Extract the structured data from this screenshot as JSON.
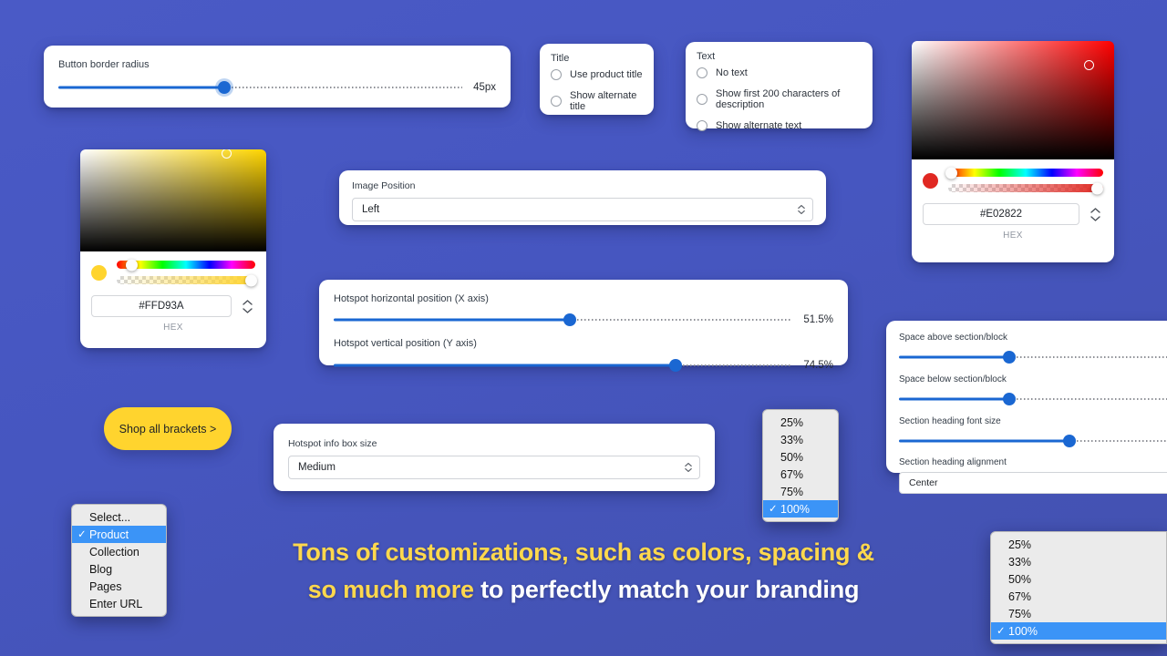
{
  "theme": {
    "background_top": "#4A5AC6",
    "background_bottom": "#4351AE",
    "accent_blue": "#1A67D2",
    "accent_yellow": "#FFD42E",
    "headline_yellow": "#FFD84D",
    "menu_highlight": "#3B94F7"
  },
  "border_radius_card": {
    "label": "Button border radius",
    "value": "45px",
    "fill_percent": 41
  },
  "title_radios": {
    "title": "Title",
    "options": [
      {
        "label": "Use product title",
        "selected": false
      },
      {
        "label": "Show alternate title",
        "selected": false
      }
    ]
  },
  "text_radios": {
    "title": "Text",
    "options": [
      {
        "label": "No text",
        "selected": false
      },
      {
        "label": "Show first 200 characters of description",
        "selected": false
      },
      {
        "label": "Show alternate text",
        "selected": false
      }
    ]
  },
  "color_picker_yellow": {
    "hex": "#FFD93A",
    "hex_label": "HEX",
    "swatch_color": "#FFD42E",
    "hue_percent": 11,
    "alpha_percent": 97,
    "sat_dot_x_percent": 76,
    "sat_dot_y_percent": 1
  },
  "color_picker_red": {
    "hex": "#E02822",
    "hex_label": "HEX",
    "swatch_color": "#E02822",
    "hue_percent": 2,
    "alpha_percent": 96,
    "sat_dot_x_percent": 85,
    "sat_dot_y_percent": 16
  },
  "image_position": {
    "label": "Image Position",
    "value": "Left"
  },
  "hotspot": {
    "x_axis": {
      "label": "Hotspot horizontal position (X axis)",
      "value": "51.5%",
      "fill_percent": 51.5
    },
    "y_axis": {
      "label": "Hotspot vertical position (Y axis)",
      "value": "74.5%",
      "fill_percent": 74.5
    }
  },
  "cta_button": {
    "label": "Shop all brackets >"
  },
  "info_box_size": {
    "label": "Hotspot info box size",
    "value": "Medium"
  },
  "spacing_panel": {
    "space_above": {
      "label": "Space above section/block",
      "fill_percent": 40
    },
    "space_below": {
      "label": "Space below section/block",
      "fill_percent": 40
    },
    "heading_font_size": {
      "label": "Section heading font size",
      "fill_percent": 62
    },
    "heading_alignment": {
      "label": "Section heading alignment",
      "value": "Center"
    }
  },
  "percent_menu_middle": {
    "items": [
      {
        "label": "25%",
        "selected": false
      },
      {
        "label": "33%",
        "selected": false
      },
      {
        "label": "50%",
        "selected": false
      },
      {
        "label": "67%",
        "selected": false
      },
      {
        "label": "75%",
        "selected": false
      },
      {
        "label": "100%",
        "selected": true
      }
    ],
    "check_glyph": "✓"
  },
  "select_menu": {
    "items": [
      {
        "label": "Select...",
        "selected": false
      },
      {
        "label": "Product",
        "selected": true
      },
      {
        "label": "Collection",
        "selected": false
      },
      {
        "label": "Blog",
        "selected": false
      },
      {
        "label": "Pages",
        "selected": false
      },
      {
        "label": "Enter URL",
        "selected": false
      }
    ],
    "check_glyph": "✓"
  },
  "percent_menu_bottom_right": {
    "items": [
      {
        "label": "25%",
        "selected": false
      },
      {
        "label": "33%",
        "selected": false
      },
      {
        "label": "50%",
        "selected": false
      },
      {
        "label": "67%",
        "selected": false
      },
      {
        "label": "75%",
        "selected": false
      },
      {
        "label": "100%",
        "selected": true
      }
    ],
    "check_glyph": "✓"
  },
  "headline": {
    "line1_highlight": "Tons of customizations, such as colors, spacing &",
    "line2_highlight": "so much more",
    "line2_rest": " to perfectly match your branding"
  }
}
